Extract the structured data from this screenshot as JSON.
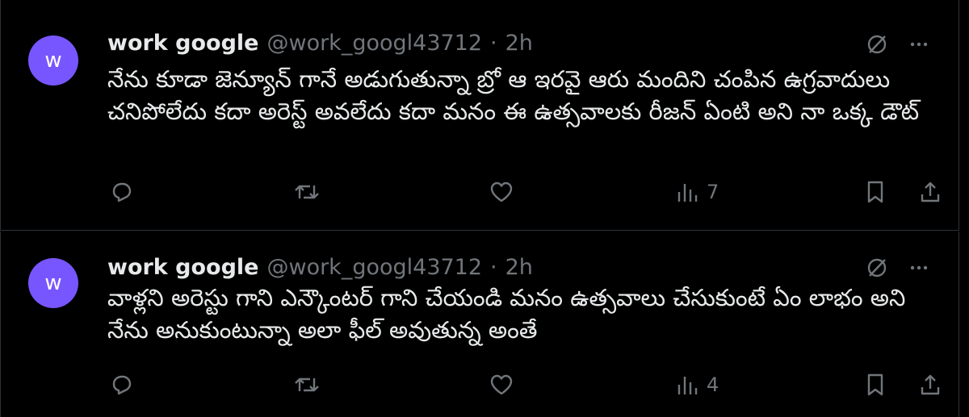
{
  "tweets": [
    {
      "avatar_letter": "w",
      "name": "work google",
      "handle": "@work_googl43712",
      "separator": "·",
      "time": "2h",
      "text": "నేను కూడా జెన్యూన్ గానే అడుగుతున్నా బ్రో ఆ ఇరవై ఆరు మందిని చంపిన ఉగ్రవాదులు చనిపోలేదు కదా అరెస్ట్ అవలేదు కదా మనం ఈ ఉత్సవాలకు రీజన్ ఏంటి అని నా ఒక్క డౌట్",
      "views": "7"
    },
    {
      "avatar_letter": "w",
      "name": "work google",
      "handle": "@work_googl43712",
      "separator": "·",
      "time": "2h",
      "text": "వాళ్లని అరెస్టు గాని ఎన్కౌంటర్ గాని చేయండి మనం ఉత్సవాలు చేసుకుంటే ఏం లాభం అని నేను అనుకుంటున్నా అలా ఫీల్ అవుతున్న అంతే",
      "views": "4"
    }
  ],
  "icons": {
    "more": "more-icon",
    "grok": "grok-icon",
    "reply": "reply-icon",
    "retweet": "retweet-icon",
    "like": "like-icon",
    "views": "views-icon",
    "bookmark": "bookmark-icon",
    "share": "share-icon"
  },
  "colors": {
    "background": "#000000",
    "text": "#e7e9ea",
    "muted": "#71767b",
    "avatar": "#7856ff",
    "border": "#2f3336"
  }
}
